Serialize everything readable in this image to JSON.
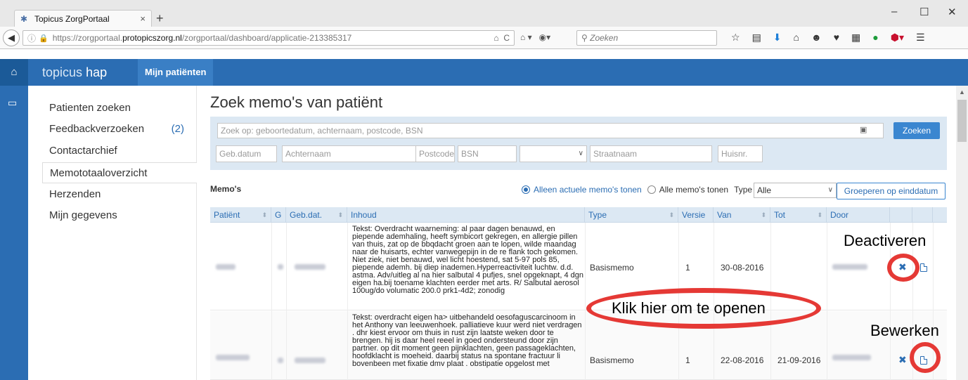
{
  "browser": {
    "tab_title": "Topicus ZorgPortaal",
    "tab_close": "×",
    "new_tab": "+",
    "url_prefix": "https://zorgportaal.",
    "url_domain": "protopicszorg.nl",
    "url_path": "/zorgportaal/dashboard/applicatie-213385317",
    "search_placeholder": "Zoeken"
  },
  "app": {
    "logo_brand": "topicus",
    "logo_product": "hap",
    "nav_active": "Mijn patiënten"
  },
  "sidebar": {
    "items": [
      {
        "label": "Patienten zoeken"
      },
      {
        "label": "Feedbackverzoeken",
        "count": "(2)"
      },
      {
        "label": "Contactarchief"
      },
      {
        "label": "Memototaaloverzicht"
      },
      {
        "label": "Herzenden"
      },
      {
        "label": "Mijn gegevens"
      }
    ]
  },
  "main": {
    "title": "Zoek memo's van patiënt",
    "search": {
      "main_placeholder": "Zoek op: geboortedatum, achternaam, postcode, BSN",
      "button": "Zoeken",
      "gebdatum": "Geb.datum",
      "achternaam": "Achternaam",
      "postcode": "Postcode",
      "bsn": "BSN",
      "straatnaam": "Straatnaam",
      "huisnr": "Huisnr."
    },
    "memos_label": "Memo's",
    "radio_current": "Alleen actuele memo's tonen",
    "radio_all": "Alle memo's tonen",
    "type_label": "Type",
    "type_value": "Alle",
    "group_button": "Groeperen op einddatum"
  },
  "table": {
    "headers": [
      "Patiënt",
      "G",
      "Geb.dat.",
      "Inhoud",
      "Type",
      "Versie",
      "Van",
      "Tot",
      "Door"
    ],
    "rows": [
      {
        "inhoud": "Tekst: Overdracht waarneming: al paar dagen benauwd, en piepende ademhaling, heeft symbicort gekregen, en allergie pillen van thuis, zat op de bbqdacht groen aan te lopen, wilde maandag naar de huisarts, echter vanwegepijn in de re flank toch gekomen. Niet ziek, niet benauwd, wel licht hoestend, sat 5-97 pols 85, piepende ademh. bij diep inademen.Hyperreactiviteit luchtw. d.d. astma. Adv/uitleg al na hier salbutal 4 pufjes, snel opgeknapt, 4 dgn eigen ha.bij toename klachten eerder met arts. R/ Salbutal aerosol 100ug/do volumatic 200.0 prk1-4d2; zonodig",
        "type": "Basismemo",
        "versie": "1",
        "van": "30-08-2016",
        "tot": ""
      },
      {
        "inhoud": "Tekst: overdracht eigen ha> uitbehandeld oesofaguscarcinoom in het Anthony van leeuwenhoek. palliatieve kuur werd niet verdragen . dhr kiest ervoor om thuis in rust zijn laatste weken door te brengen. hij is daar heel reeel in goed ondersteund door zijn partner. op dit moment geen pijnklachten, geen passageklachten, hoofdklacht is moeheid. daarbij status na spontane fractuur li bovenbeen met fixatie dmv plaat . obstipatie opgelost met",
        "type": "Basismemo",
        "versie": "1",
        "van": "22-08-2016",
        "tot": "21-09-2016"
      }
    ]
  },
  "annotations": {
    "deactiveren": "Deactiveren",
    "openen": "Klik hier om te openen",
    "bewerken": "Bewerken",
    "color": "#e53935"
  },
  "colors": {
    "brand": "#2b6db3",
    "panel": "#dce8f3"
  }
}
